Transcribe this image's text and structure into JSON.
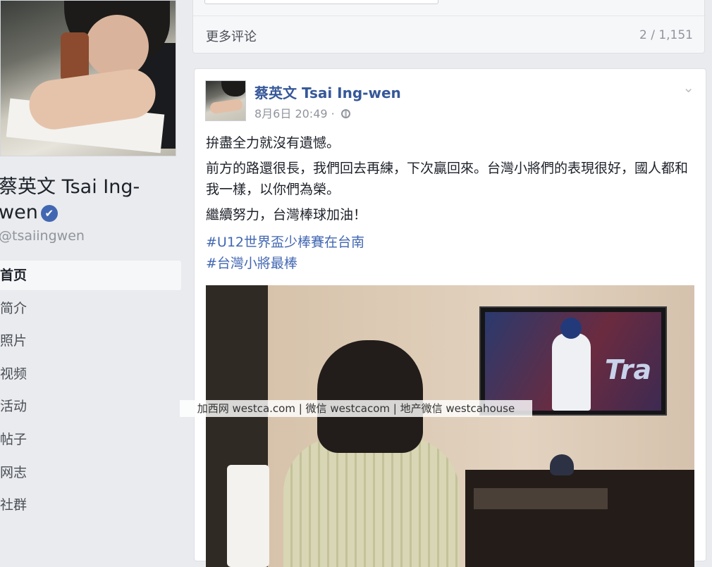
{
  "sidebar": {
    "profile_name": "蔡英文 Tsai Ing-wen",
    "profile_handle": "@tsaiingwen",
    "verified_icon": "✔",
    "nav_items": [
      {
        "label": "首页",
        "active": true
      },
      {
        "label": "简介",
        "active": false
      },
      {
        "label": "照片",
        "active": false
      },
      {
        "label": "视频",
        "active": false
      },
      {
        "label": "活动",
        "active": false
      },
      {
        "label": "帖子",
        "active": false
      },
      {
        "label": "网志",
        "active": false
      },
      {
        "label": "社群",
        "active": false
      }
    ]
  },
  "comments": {
    "more_label": "更多评论",
    "count": "2 / 1,151"
  },
  "post": {
    "author": "蔡英文 Tsai Ing-wen",
    "timestamp": "8月6日 20:49 · ",
    "chevron": "⌄",
    "paragraphs": [
      "拚盡全力就沒有遺憾。",
      "前方的路還很長，我們回去再練，下次贏回來。台灣小將們的表現很好，國人都和我一樣，以你們為榮。",
      "繼續努力，台灣棒球加油！"
    ],
    "hashtags": [
      "#U12世界盃少棒賽在台南",
      "#台灣小將最棒"
    ],
    "photo": {
      "tv_text": "Tra"
    }
  },
  "watermark": "加西网 westca.com | 微信 westcacom | 地产微信 westcahouse",
  "colors": {
    "link_blue": "#4267b2",
    "author_blue": "#365899",
    "background": "#e9ebee"
  }
}
